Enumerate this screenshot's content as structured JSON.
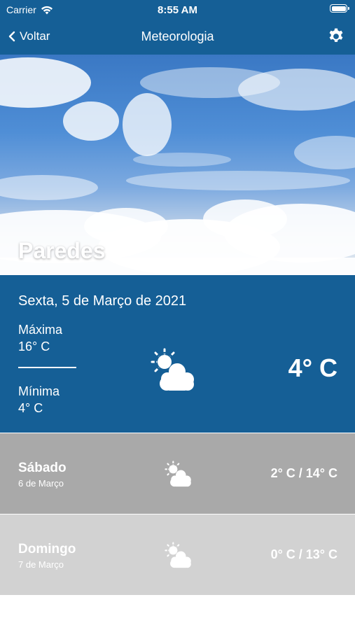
{
  "status_bar": {
    "carrier": "Carrier",
    "time": "8:55 AM"
  },
  "nav": {
    "back_label": "Voltar",
    "title": "Meteorologia"
  },
  "location": {
    "city": "Paredes"
  },
  "today": {
    "date": "Sexta, 5 de Março de 2021",
    "max_label": "Máxima",
    "max_value": "16° C",
    "min_label": "Mínima",
    "min_value": "4° C",
    "current_temp": "4° C",
    "icon": "partly-cloudy-icon"
  },
  "forecast": [
    {
      "day": "Sábado",
      "date": "6 de Março",
      "range": "2° C / 14° C",
      "icon": "partly-cloudy-icon"
    },
    {
      "day": "Domingo",
      "date": "7 de Março",
      "range": "0° C / 13° C",
      "icon": "partly-cloudy-icon"
    }
  ],
  "colors": {
    "primary": "#155f96",
    "row1": "#a9a9a9",
    "row2": "#d2d2d2"
  }
}
